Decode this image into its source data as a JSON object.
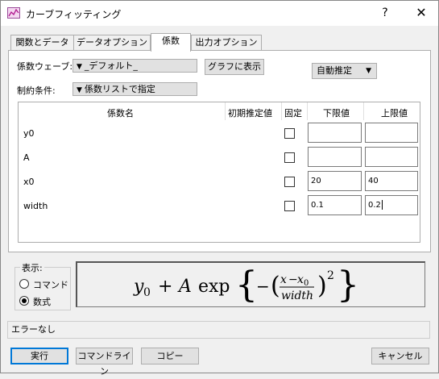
{
  "window": {
    "title": "カーブフィッティング",
    "help": "?",
    "close": "✕"
  },
  "tabs": [
    {
      "label": "関数とデータ"
    },
    {
      "label": "データオプション"
    },
    {
      "label": "係数"
    },
    {
      "label": "出力オプション"
    }
  ],
  "coef_panel": {
    "wave_label": "係数ウェーブ:",
    "wave_value": "_デフォルト_",
    "graph_button": "グラフに表示",
    "auto_guess": "自動推定",
    "constraint_label": "制約条件:",
    "constraint_value": "係数リストで指定"
  },
  "table": {
    "headers": [
      "係数名",
      "初期推定値",
      "固定",
      "下限値",
      "上限値"
    ],
    "rows": [
      {
        "name": "y0",
        "guess": "",
        "fixed": false,
        "lower": "",
        "upper": ""
      },
      {
        "name": "A",
        "guess": "",
        "fixed": false,
        "lower": "",
        "upper": ""
      },
      {
        "name": "x0",
        "guess": "",
        "fixed": false,
        "lower": "20",
        "upper": "40"
      },
      {
        "name": "width",
        "guess": "",
        "fixed": false,
        "lower": "0.1",
        "upper": "0.2"
      }
    ]
  },
  "display": {
    "group_title": "表示:",
    "options": [
      {
        "label": "コマンド",
        "selected": false
      },
      {
        "label": "数式",
        "selected": true
      }
    ]
  },
  "formula": {
    "y0": "y",
    "y0_sub": "0",
    "plus": "+",
    "A": "A",
    "exp": "exp",
    "minus": "−",
    "numer_x": "x",
    "numer_minus": "−",
    "numer_x0": "x",
    "numer_x0_sub": "0",
    "denom": "width",
    "power": "2"
  },
  "status": {
    "message": "エラーなし"
  },
  "footer": {
    "run": "実行",
    "command_line": "コマンドライン",
    "copy": "コピー",
    "cancel": "キャンセル"
  }
}
